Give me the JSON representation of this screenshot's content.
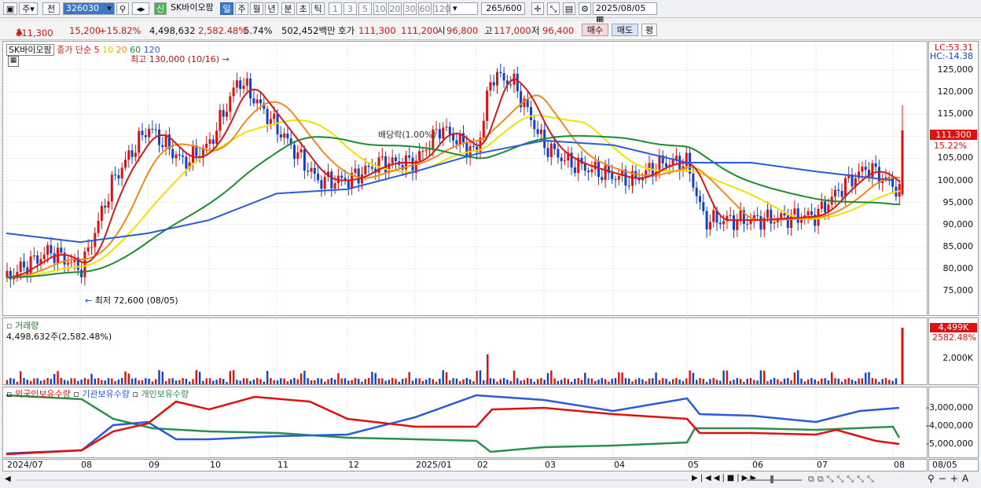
{
  "toolbar": {
    "period_label": "주",
    "prev_label": "전",
    "stock_code": "326030",
    "new_label": "신",
    "stock_name": "SK바이오팜",
    "period_buttons": [
      "일",
      "주",
      "월",
      "년",
      "분",
      "초",
      "틱"
    ],
    "interval_buttons": [
      "1",
      "3",
      "5",
      "10",
      "20",
      "30",
      "60",
      "120"
    ],
    "count_display": "265",
    "count_total": "/600",
    "date_value": "2025/08/05"
  },
  "quote": {
    "price": "111,300",
    "change": "15,200",
    "change_rate": "+15.82%",
    "volume": "4,498,632",
    "volume_rate": "2,582.48%",
    "turnover": "5.74%",
    "amount": "502,452백만",
    "hoga_label": "호가",
    "ask": "111,300",
    "bid": "111,200",
    "open_label": "시",
    "open": "96,800",
    "high_label": "고",
    "high": "117,000",
    "low_label": "저",
    "low": "96,400",
    "buy_label": "매수",
    "sell_label": "매도",
    "eval_label": "평"
  },
  "price_panel": {
    "stock_tag": "SK바이오팜",
    "ma_title": "종가 단순",
    "ma_periods": [
      "5",
      "10",
      "20",
      "60",
      "120"
    ],
    "high_annotation": "최고 130,000 (10/16)",
    "low_annotation": "최저 72,600 (08/05)",
    "dividend_annotation": "배당락(1.00%)",
    "lc": "LC:53.31",
    "hc": "HC:-14.38",
    "current_price_tag": "111,300",
    "current_rate_tag": "15.22%",
    "y_ticks": [
      "125,000",
      "120,000",
      "115,000",
      "110,000",
      "105,000",
      "100,000",
      "95,000",
      "90,000",
      "85,000",
      "80,000",
      "75,000"
    ]
  },
  "volume_panel": {
    "title": "거래량",
    "value": "4,498,632주(2,582.48%)",
    "tag_value": "4,499K",
    "tag_rate": "2582.48%",
    "y_tick": "2,000K"
  },
  "holdings_panel": {
    "series": [
      "외국인보유수량",
      "기관보유수량",
      "개인보유수량"
    ],
    "y_ticks": [
      "-3,000,000",
      "-4,000,000",
      "-5,000,000"
    ]
  },
  "x_axis": {
    "labels": [
      "2024/07",
      "08",
      "09",
      "10",
      "11",
      "12",
      "2025/01",
      "02",
      "03",
      "04",
      "05",
      "06",
      "07",
      "08"
    ],
    "current_label": "08/05"
  },
  "colors": {
    "up": "#e01010",
    "down": "#1040d0",
    "ma5": "#d81818",
    "ma10": "#f08a1c",
    "ma20": "#f4e000",
    "ma60": "#1c8c30",
    "ma120": "#2c5ad8",
    "foreign": "#e01010",
    "institution": "#2c5ad8",
    "individual": "#2a9050"
  },
  "chart_data": {
    "type": "line",
    "title": "",
    "x": [
      "2024-07-01",
      "2024-08-05",
      "2024-09-01",
      "2024-10-16",
      "2024-11-15",
      "2024-12-15",
      "2025-01-15",
      "2025-02-15",
      "2025-03-15",
      "2025-04-15",
      "2025-05-15",
      "2025-06-15",
      "2025-07-15",
      "2025-08-05"
    ],
    "series": [
      {
        "name": "5",
        "values": [
          78000,
          78000,
          112000,
          123000,
          112000,
          100000,
          104000,
          122000,
          104000,
          101000,
          89000,
          91000,
          101000,
          97000
        ]
      },
      {
        "name": "120",
        "values": [
          88000,
          86000,
          88000,
          91000,
          97000,
          98000,
          102000,
          106000,
          109000,
          108000,
          104000,
          104000,
          102000,
          100000
        ]
      }
    ],
    "ylim": [
      70000,
      130000
    ]
  }
}
